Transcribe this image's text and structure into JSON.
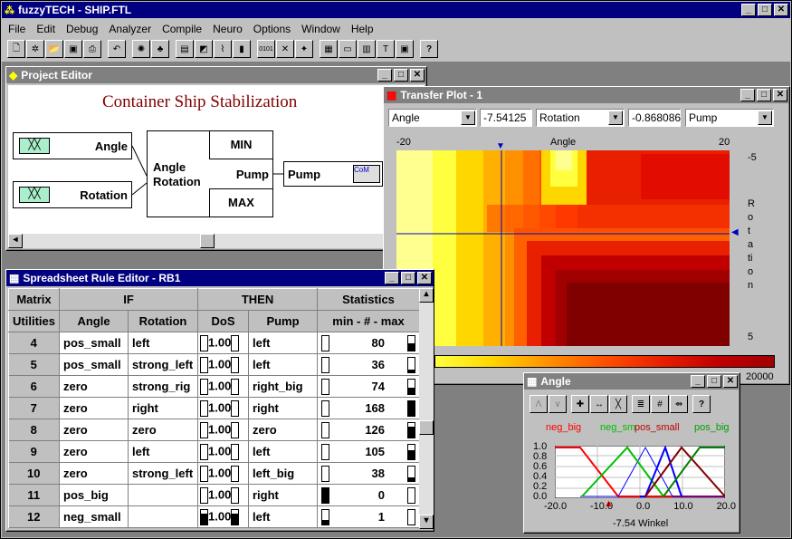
{
  "app": {
    "title": "fuzzyTECH - SHIP.FTL",
    "menu": [
      "File",
      "Edit",
      "Debug",
      "Analyzer",
      "Compile",
      "Neuro",
      "Options",
      "Window",
      "Help"
    ]
  },
  "project": {
    "title": "Project Editor",
    "heading": "Container Ship Stabilization",
    "inputs": [
      "Angle",
      "Rotation"
    ],
    "rulebox": "Angle\nRotation",
    "min": "MIN",
    "pump_label": "Pump",
    "max": "MAX",
    "output": "Pump",
    "com_label": "CoM"
  },
  "transfer": {
    "title": "Transfer Plot - 1",
    "sel_x": "Angle",
    "val_x": "-7.54125",
    "sel_y": "Rotation",
    "val_y": "-0.868086",
    "sel_out": "Pump",
    "x_min": "-20",
    "x_label": "Angle",
    "x_max": "20",
    "y_top": "-5",
    "y_bottom": "5",
    "y_label": "Rotation",
    "scale_max": "20000"
  },
  "rules": {
    "title": "Spreadsheet Rule Editor - RB1",
    "head1": [
      "Matrix",
      "IF",
      "THEN",
      "Statistics"
    ],
    "head2": [
      "Utilities",
      "Angle",
      "Rotation",
      "DoS",
      "Pump",
      "min - # - max"
    ],
    "rows": [
      {
        "n": "4",
        "a": "pos_small",
        "r": "left",
        "dos": "1.00",
        "p": "left",
        "c": "80"
      },
      {
        "n": "5",
        "a": "pos_small",
        "r": "strong_left",
        "dos": "1.00",
        "p": "left",
        "c": "36"
      },
      {
        "n": "6",
        "a": "zero",
        "r": "strong_rig",
        "dos": "1.00",
        "p": "right_big",
        "c": "74"
      },
      {
        "n": "7",
        "a": "zero",
        "r": "right",
        "dos": "1.00",
        "p": "right",
        "c": "168"
      },
      {
        "n": "8",
        "a": "zero",
        "r": "zero",
        "dos": "1.00",
        "p": "zero",
        "c": "126"
      },
      {
        "n": "9",
        "a": "zero",
        "r": "left",
        "dos": "1.00",
        "p": "left",
        "c": "105"
      },
      {
        "n": "10",
        "a": "zero",
        "r": "strong_left",
        "dos": "1.00",
        "p": "left_big",
        "c": "38"
      },
      {
        "n": "11",
        "a": "pos_big",
        "r": "",
        "dos": "1.00",
        "p": "right",
        "c": "0"
      },
      {
        "n": "12",
        "a": "neg_small",
        "r": "",
        "dos": "1.00",
        "p": "left",
        "c": "1"
      }
    ]
  },
  "angle": {
    "title": "Angle",
    "terms": [
      "neg_big",
      "neg_sm",
      "pos_small",
      "pos_big"
    ],
    "term_colors": [
      "#ff0000",
      "#00c000",
      "#c00000",
      "#00a000"
    ],
    "yticks": [
      "1.0",
      "0.8",
      "0.6",
      "0.4",
      "0.2",
      "0.0"
    ],
    "xticks": [
      "-20.0",
      "-10.0",
      "0.0",
      "10.0",
      "20.0"
    ],
    "readout": "-7.54 Winkel"
  }
}
